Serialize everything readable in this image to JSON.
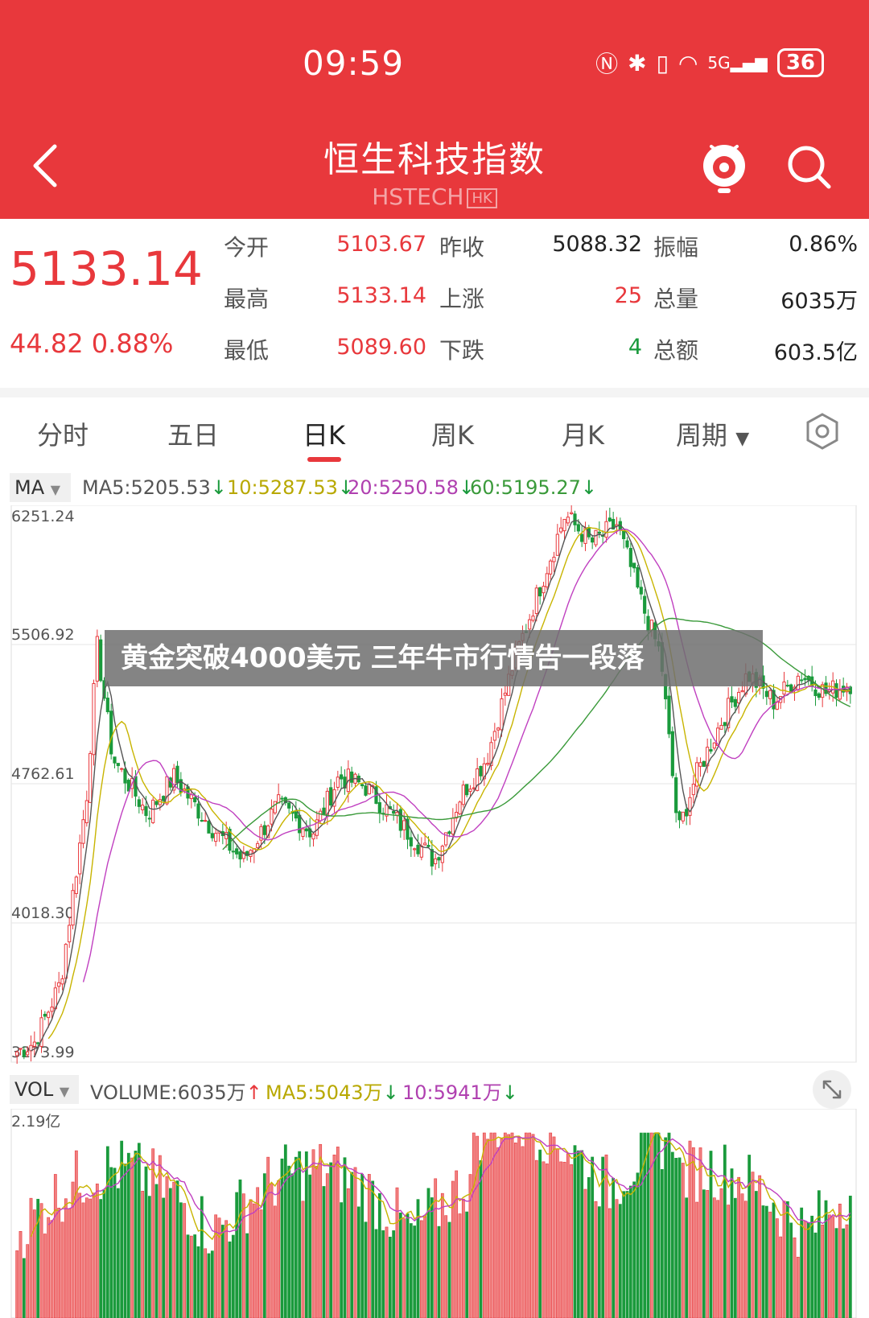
{
  "status_bar": {
    "time": "09:59",
    "battery": "36",
    "network": "5G"
  },
  "header": {
    "title": "恒生科技指数",
    "subtitle": "HSTECH",
    "badge": "HK"
  },
  "quote": {
    "price": "5133.14",
    "change": "44.82",
    "change_pct": "0.88%",
    "open_label": "今开",
    "open": "5103.67",
    "prev_close_label": "昨收",
    "prev_close": "5088.32",
    "amplitude_label": "振幅",
    "amplitude": "0.86%",
    "high_label": "最高",
    "high": "5133.14",
    "up_label": "上涨",
    "up": "25",
    "volume_label": "总量",
    "volume": "6035万",
    "low_label": "最低",
    "low": "5089.60",
    "down_label": "下跌",
    "down": "4",
    "turnover_label": "总额",
    "turnover": "603.5亿"
  },
  "tabs": [
    "分时",
    "五日",
    "日K",
    "周K",
    "月K",
    "周期"
  ],
  "ma": {
    "selector": "MA",
    "ma5": "MA5:5205.53",
    "ma10": "10:5287.53",
    "ma20": "20:5250.58",
    "ma60": "60:5195.27"
  },
  "vol": {
    "selector": "VOL",
    "volume": "VOLUME:6035万",
    "ma5": "MA5:5043万",
    "ma10": "10:5941万",
    "top_label": "2.19亿"
  },
  "banner": "黄金突破4000美元 三年牛市行情告一段落",
  "colors": {
    "up": "#e8383c",
    "down": "#1a9a3c",
    "ma5": "#555555",
    "ma10": "#c8b400",
    "ma20": "#c040c0",
    "ma60": "#3a9a3a"
  },
  "chart_data": {
    "type": "candlestick",
    "ylim": [
      3273.99,
      6251.24
    ],
    "y_ticks": [
      "6251.24",
      "5506.92",
      "4762.61",
      "4018.30",
      "3273.99"
    ],
    "ma_overlays": [
      "MA5",
      "MA10",
      "MA20",
      "MA60"
    ],
    "volume_max_label": "2.19亿"
  }
}
